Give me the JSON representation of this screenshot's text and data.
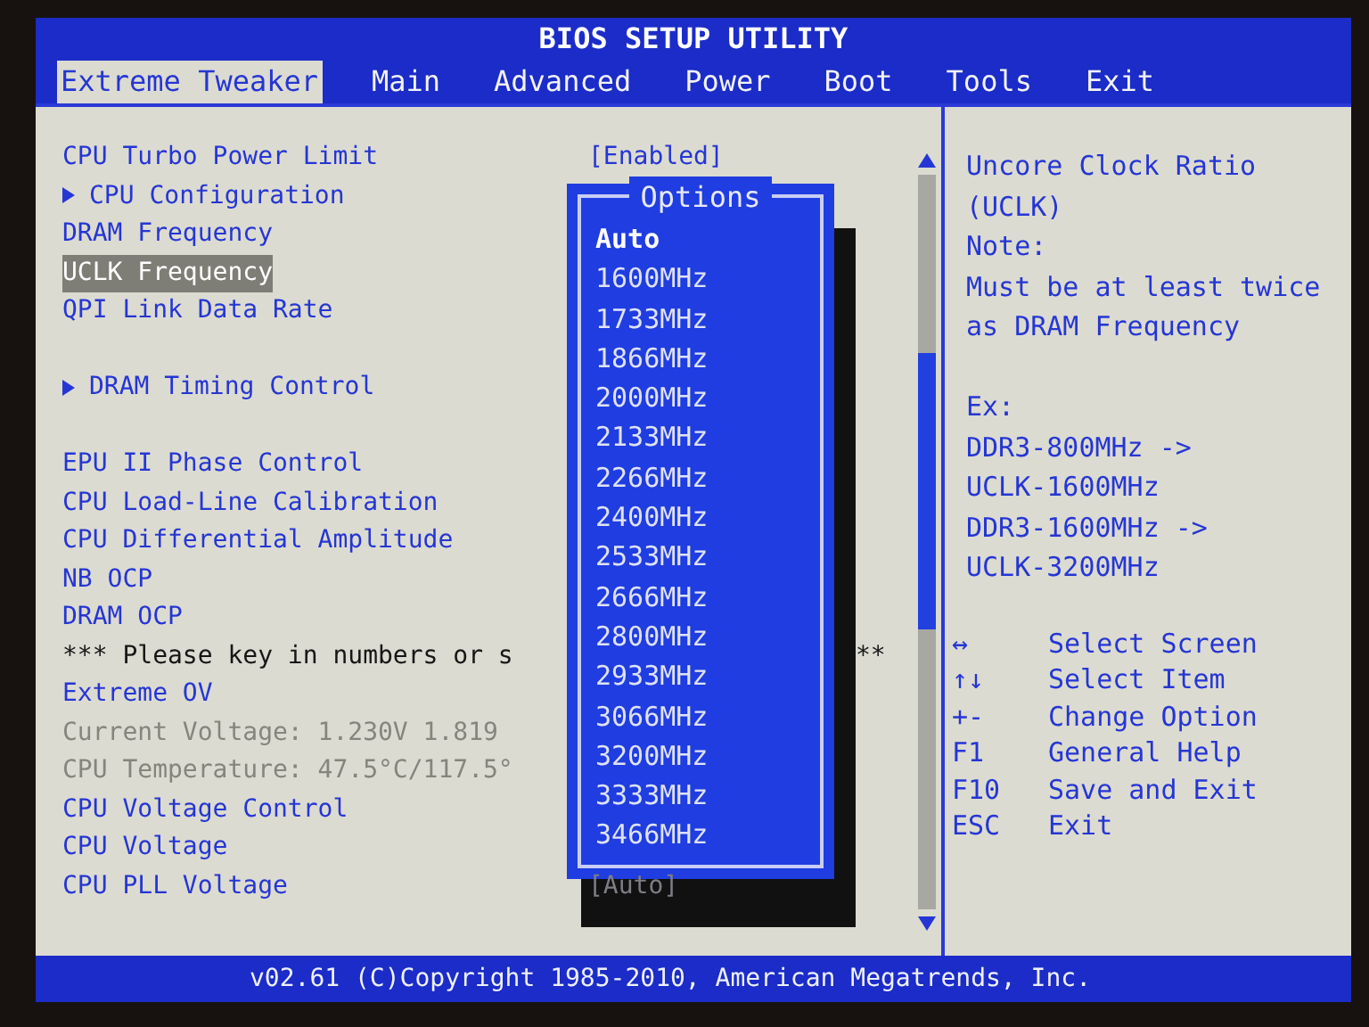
{
  "window": {
    "title": "BIOS SETUP UTILITY"
  },
  "tabs": [
    {
      "label": "Extreme Tweaker",
      "selected": true
    },
    {
      "label": "Main",
      "selected": false
    },
    {
      "label": "Advanced",
      "selected": false
    },
    {
      "label": "Power",
      "selected": false
    },
    {
      "label": "Boot",
      "selected": false
    },
    {
      "label": "Tools",
      "selected": false
    },
    {
      "label": "Exit",
      "selected": false
    }
  ],
  "settings": [
    {
      "kind": "item",
      "label": "CPU Turbo Power Limit",
      "value": "[Enabled]",
      "selected": false
    },
    {
      "kind": "submenu",
      "label": "CPU Configuration",
      "selected": false
    },
    {
      "kind": "item",
      "label": "DRAM Frequency",
      "selected": false
    },
    {
      "kind": "item",
      "label": "UCLK Frequency",
      "selected": true
    },
    {
      "kind": "item",
      "label": "QPI Link Data Rate",
      "selected": false
    },
    {
      "kind": "blank"
    },
    {
      "kind": "submenu",
      "label": "DRAM Timing Control",
      "selected": false
    },
    {
      "kind": "blank"
    },
    {
      "kind": "item",
      "label": "EPU II Phase Control",
      "selected": false
    },
    {
      "kind": "item",
      "label": "CPU Load-Line Calibration",
      "selected": false
    },
    {
      "kind": "item",
      "label": "CPU Differential Amplitude",
      "selected": false
    },
    {
      "kind": "item",
      "label": "NB OCP",
      "selected": false
    },
    {
      "kind": "item",
      "label": "DRAM OCP",
      "selected": false
    },
    {
      "kind": "note",
      "label": "*** Please key in numbers or s",
      "tail": "**"
    },
    {
      "kind": "item",
      "label": "Extreme OV",
      "selected": false
    },
    {
      "kind": "info",
      "label": "Current Voltage: 1.230V  1.819"
    },
    {
      "kind": "info",
      "label": "CPU Temperature: 47.5°C/117.5°"
    },
    {
      "kind": "item",
      "label": "CPU Voltage Control",
      "selected": false
    },
    {
      "kind": "item",
      "label": "CPU Voltage",
      "selected": false
    },
    {
      "kind": "item",
      "label": "CPU PLL Voltage",
      "value": "[Auto]",
      "selected": false
    }
  ],
  "options_popup": {
    "title": "Options",
    "options": [
      {
        "label": "Auto",
        "selected": true
      },
      {
        "label": "1600MHz",
        "selected": false
      },
      {
        "label": "1733MHz",
        "selected": false
      },
      {
        "label": "1866MHz",
        "selected": false
      },
      {
        "label": "2000MHz",
        "selected": false
      },
      {
        "label": "2133MHz",
        "selected": false
      },
      {
        "label": "2266MHz",
        "selected": false
      },
      {
        "label": "2400MHz",
        "selected": false
      },
      {
        "label": "2533MHz",
        "selected": false
      },
      {
        "label": "2666MHz",
        "selected": false
      },
      {
        "label": "2800MHz",
        "selected": false
      },
      {
        "label": "2933MHz",
        "selected": false
      },
      {
        "label": "3066MHz",
        "selected": false
      },
      {
        "label": "3200MHz",
        "selected": false
      },
      {
        "label": "3333MHz",
        "selected": false
      },
      {
        "label": "3466MHz",
        "selected": false
      }
    ]
  },
  "help": {
    "paragraphs": [
      [
        "Uncore Clock Ratio",
        "(UCLK)",
        "Note:",
        "Must be at least twice",
        "as DRAM Frequency"
      ],
      [
        "Ex:",
        "DDR3-800MHz ->",
        "UCLK-1600MHz",
        "DDR3-1600MHz ->",
        "UCLK-3200MHz"
      ]
    ],
    "keys": [
      {
        "key": "↔",
        "action": "Select Screen"
      },
      {
        "key": "↑↓",
        "action": "Select Item"
      },
      {
        "key": "+-",
        "action": "Change Option"
      },
      {
        "key": "F1",
        "action": "General Help"
      },
      {
        "key": "F10",
        "action": "Save and Exit"
      },
      {
        "key": "ESC",
        "action": "Exit"
      }
    ]
  },
  "status_bar": "v02.61 (C)Copyright 1985-2010, American Megatrends, Inc."
}
